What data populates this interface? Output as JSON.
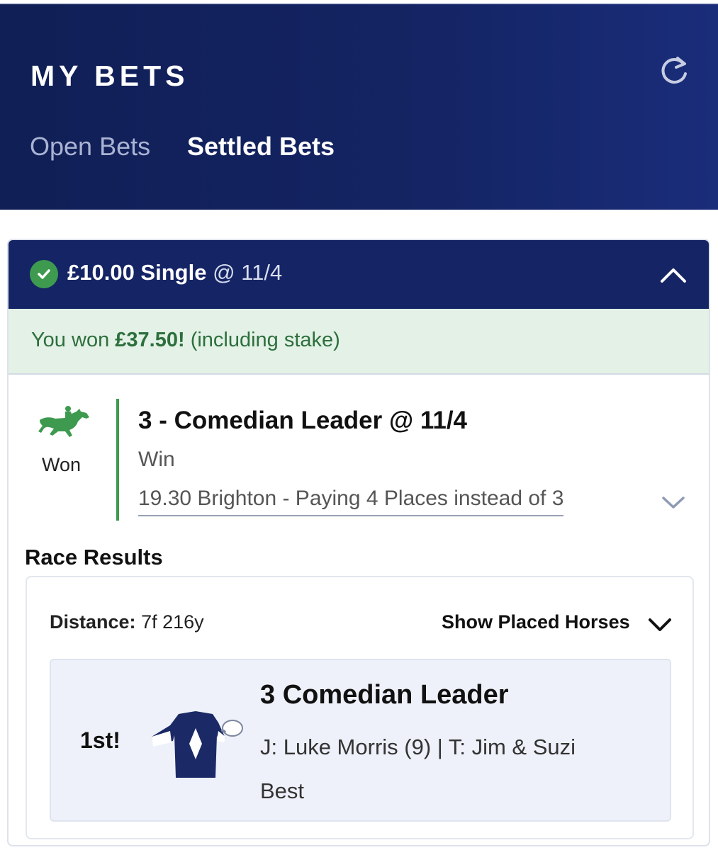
{
  "header": {
    "title": "MY BETS",
    "tabs": [
      {
        "label": "Open Bets",
        "active": false
      },
      {
        "label": "Settled Bets",
        "active": true
      }
    ],
    "refresh_icon": "refresh-icon"
  },
  "bet": {
    "status_icon": "check-circle-icon",
    "stake_type": "£10.00 Single",
    "odds": "@ 11/4",
    "collapse_icon": "chevron-up-icon",
    "won_prefix": "You won",
    "won_amount": "£37.50!",
    "won_suffix": "(including stake)",
    "selection": {
      "result_icon": "horse-racing-icon",
      "result_label": "Won",
      "name": "3 - Comedian Leader @ 11/4",
      "market": "Win",
      "event": "19.30 Brighton - Paying 4 Places instead of 3",
      "expand_icon": "chevron-down-icon"
    },
    "race_results": {
      "title": "Race Results",
      "distance_label": "Distance:",
      "distance_value": "7f 216y",
      "show_placed_label": "Show Placed Horses",
      "runner": {
        "position": "1st!",
        "name": "3 Comedian Leader",
        "jockey_trainer": "J: Luke Morris (9) | T: Jim & Suzi Best"
      }
    }
  },
  "colors": {
    "header_bg": "#142464",
    "win_green": "#3d9a4f",
    "won_banner_bg": "#e3f1e6",
    "runner_bg": "#eef1f9"
  }
}
